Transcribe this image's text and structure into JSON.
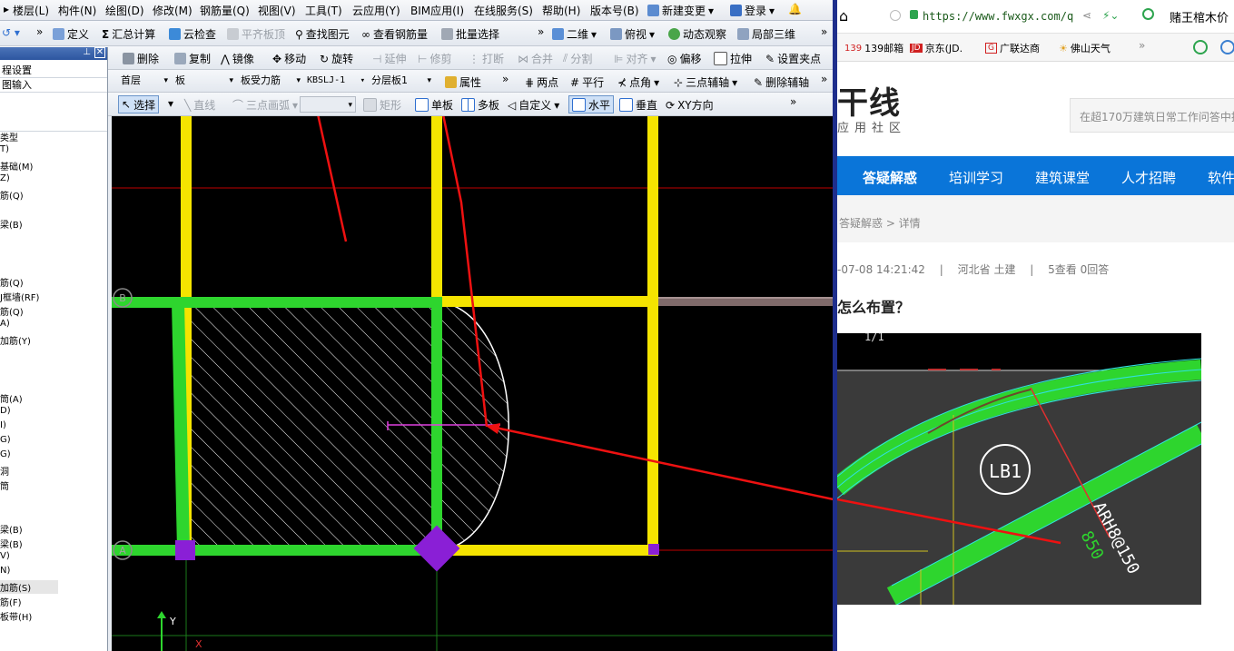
{
  "menu": [
    "楼层(L)",
    "构件(N)",
    "绘图(D)",
    "修改(M)",
    "钢筋量(Q)",
    "视图(V)",
    "工具(T)",
    "云应用(Y)",
    "BIM应用(I)",
    "在线服务(S)",
    "帮助(H)",
    "版本号(B)",
    "新建变更",
    "登录"
  ],
  "toolbar1": {
    "define": "定义",
    "sum": "汇总计算",
    "cloud_check": "云检查",
    "flat_top": "平齐板顶",
    "find": "查找图元",
    "view_rebar": "查看钢筋量",
    "batch": "批量选择",
    "view2d": "二维",
    "plan": "俯视",
    "dynamic": "动态观察",
    "local3d": "局部三维"
  },
  "toolbar2": {
    "delete": "删除",
    "copy": "复制",
    "mirror": "镜像",
    "move": "移动",
    "rotate": "旋转",
    "extend": "延伸",
    "trim": "修剪",
    "break": "打断",
    "merge": "合并",
    "split": "分割",
    "align": "对齐",
    "offset": "偏移",
    "stretch": "拉伸",
    "set_grip": "设置夹点"
  },
  "toolbar3": {
    "floor": "首层",
    "component": "板",
    "rebar_type": "板受力筋",
    "name": "KBSLJ-1",
    "layer": "分层板1",
    "props": "属性",
    "two_point": "两点",
    "parallel": "平行",
    "point_angle": "点角",
    "three_point_axis": "三点辅轴",
    "delete_axis": "删除辅轴"
  },
  "toolbar4": {
    "select": "选择",
    "line": "直线",
    "arc": "三点画弧",
    "rect": "矩形",
    "single": "单板",
    "multi": "多板",
    "custom": "自定义",
    "horizontal": "水平",
    "vertical": "垂直",
    "xy": "XY方向"
  },
  "sidebar": {
    "head": "程设置",
    "sub": "图输入",
    "items": [
      "类型",
      "T)",
      "基础(M)",
      "Z)",
      "筋(Q)",
      "梁(B)",
      "筋(Q)",
      "J框墙(RF)",
      "筋(Q)",
      "A)",
      "加筋(Y)",
      "筒(A)",
      "D)",
      "I)",
      "G)",
      "G)",
      "洞",
      "筒",
      "梁(B)",
      "梁(B)",
      "V)",
      "N)",
      "加筋(S)",
      "筋(F)",
      "板带(H)"
    ]
  },
  "canvas": {
    "axis_labels": [
      "B",
      "A"
    ],
    "y_axis": "Y",
    "x_axis": "X"
  },
  "browser": {
    "url": "https://www.fwxgx.com/q",
    "ad_text": "赌王棺木价",
    "bookmarks": [
      "139邮箱",
      "京东(JD.",
      "广联达商",
      "佛山天气"
    ],
    "logo_main": "干线",
    "logo_sub": "应用社区",
    "search_placeholder": "在超170万建筑日常工作问答中搜",
    "nav": [
      "答疑解惑",
      "培训学习",
      "建筑课堂",
      "人才招聘",
      "软件"
    ],
    "breadcrumb": "答疑解惑 > 详情",
    "meta_time": "-07-08 14:21:42",
    "meta_location": "河北省  土建",
    "meta_views": "5查看  0回答",
    "question": "怎么布置？",
    "drawing_labels": {
      "slab": "LB1",
      "rebar": "ARH8@150",
      "dim": "850"
    }
  }
}
